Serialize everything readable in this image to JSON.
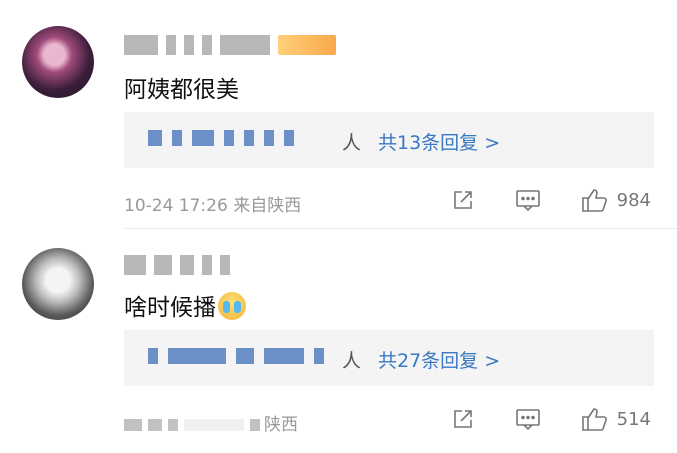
{
  "comments": [
    {
      "text": "阿姨都很美",
      "reply_suffix": "人",
      "reply_link": "共13条回复 >",
      "meta": "10-24 17:26 来自陕西",
      "likes": "984"
    },
    {
      "text": "啥时候播",
      "reply_suffix": "人",
      "reply_link": "共27条回复 >",
      "meta": "陕西",
      "likes": "514"
    }
  ],
  "icons": [
    "share-icon",
    "comment-icon",
    "like-icon",
    "crying-emoji"
  ]
}
